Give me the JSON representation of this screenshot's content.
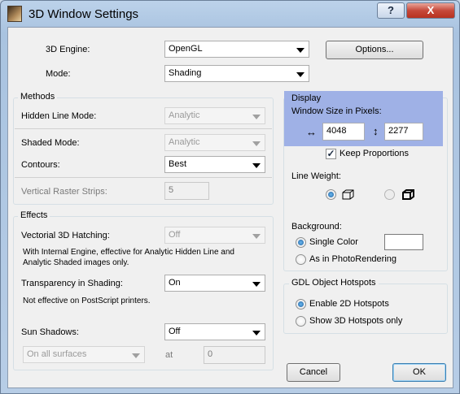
{
  "window": {
    "title": "3D Window Settings",
    "help_glyph": "?",
    "close_glyph": "X"
  },
  "top": {
    "engine_label": "3D Engine:",
    "engine_value": "OpenGL",
    "mode_label": "Mode:",
    "mode_value": "Shading",
    "options_button": "Options..."
  },
  "methods": {
    "title": "Methods",
    "hidden_line_label": "Hidden Line Mode:",
    "hidden_line_value": "Analytic",
    "shaded_mode_label": "Shaded Mode:",
    "shaded_mode_value": "Analytic",
    "contours_label": "Contours:",
    "contours_value": "Best",
    "raster_label": "Vertical Raster Strips:",
    "raster_value": "5"
  },
  "effects": {
    "title": "Effects",
    "hatching_label": "Vectorial 3D Hatching:",
    "hatching_value": "Off",
    "hatching_note": "With Internal Engine, effective for Analytic Hidden Line and Analytic Shaded images only.",
    "transparency_label": "Transparency in Shading:",
    "transparency_value": "On",
    "transparency_note": "Not effective on PostScript printers.",
    "sun_label": "Sun Shadows:",
    "sun_value": "Off",
    "surfaces_value": "On all surfaces",
    "at_label": "at",
    "at_value": "0"
  },
  "display": {
    "title": "Display",
    "window_size_label": "Window Size in Pixels:",
    "width_value": "4048",
    "height_value": "2277",
    "width_glyph": "↔",
    "height_glyph": "↕",
    "keep_proportions_label": "Keep Proportions",
    "keep_proportions_checked": true,
    "line_weight_label": "Line Weight:",
    "background_label": "Background:",
    "single_color_label": "Single Color",
    "photo_rendering_label": "As in PhotoRendering"
  },
  "gdl": {
    "title": "GDL Object Hotspots",
    "enable_2d_label": "Enable 2D Hotspots",
    "show_3d_label": "Show 3D Hotspots only"
  },
  "buttons": {
    "cancel": "Cancel",
    "ok": "OK"
  },
  "colors": {
    "highlight": "#9fb1e6",
    "title_bar": "#a9c3e0",
    "close_button": "#c6493a"
  }
}
